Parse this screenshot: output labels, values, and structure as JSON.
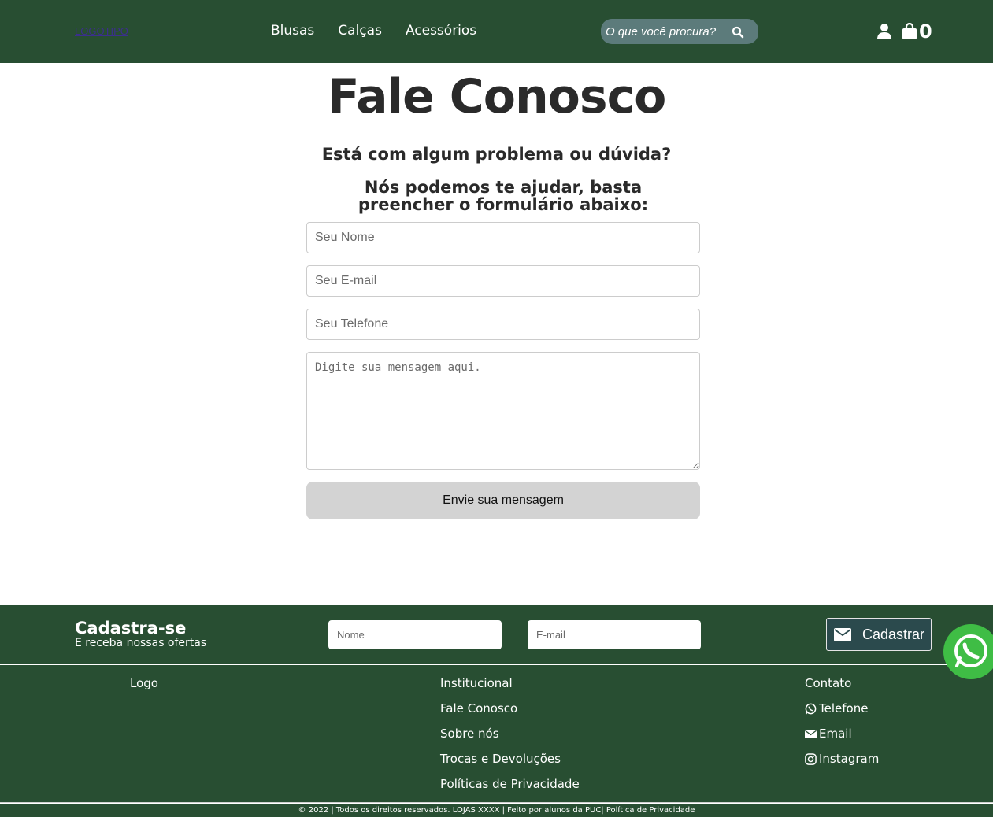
{
  "header": {
    "logo": "LOGOTIPO",
    "nav": [
      "Blusas",
      "Calças",
      "Acessórios"
    ],
    "search_placeholder": "O que você procura?",
    "cart_count": "0"
  },
  "main": {
    "title": "Fale Conosco",
    "subtitle1": "Está com algum problema ou dúvida?",
    "subtitle2": "Nós podemos te ajudar, basta preencher o formulário abaixo:",
    "name_placeholder": "Seu Nome",
    "email_placeholder": "Seu E-mail",
    "phone_placeholder": "Seu Telefone",
    "message_placeholder": "Digite sua mensagem aqui.",
    "send_label": "Envie sua mensagem"
  },
  "newsletter": {
    "title": "Cadastra-se",
    "subtitle": "E receba nossas ofertas",
    "name_placeholder": "Nome",
    "email_placeholder": "E-mail",
    "button_label": "Cadastrar"
  },
  "footer": {
    "col1": [
      "Logo"
    ],
    "col2": [
      "Institucional",
      "Fale Conosco",
      "Sobre nós",
      "Trocas e Devoluções",
      "Políticas de Privacidade"
    ],
    "col3_title": "Contato",
    "col3": [
      "Telefone",
      "Email",
      "Instagram"
    ],
    "copyright": "© 2022 | Todos os direitos reservados. LOJAS XXXX | Feito por alunos da PUC| Política de Privacidade"
  },
  "colors": {
    "header_bg": "#284e32",
    "search_bg": "#5c7b7b",
    "whatsapp": "#3fbd45"
  }
}
